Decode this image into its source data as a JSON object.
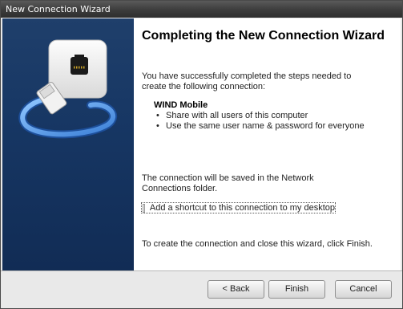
{
  "window": {
    "title": "New Connection Wizard"
  },
  "content": {
    "heading": "Completing the New Connection Wizard",
    "intro": "You have successfully completed the steps needed to create the following connection:",
    "connection_name": "WIND Mobile",
    "bullets": [
      "Share with all users of this computer",
      "Use the same user name & password for everyone"
    ],
    "save_note": "The connection will be saved in the Network Connections folder.",
    "shortcut_label": "Add a shortcut to this connection to my desktop",
    "shortcut_checked": false,
    "finish_note": "To create the connection and close this wizard, click Finish."
  },
  "buttons": {
    "back": "< Back",
    "finish": "Finish",
    "cancel": "Cancel"
  },
  "icons": {
    "banner": "network-cable-icon"
  }
}
